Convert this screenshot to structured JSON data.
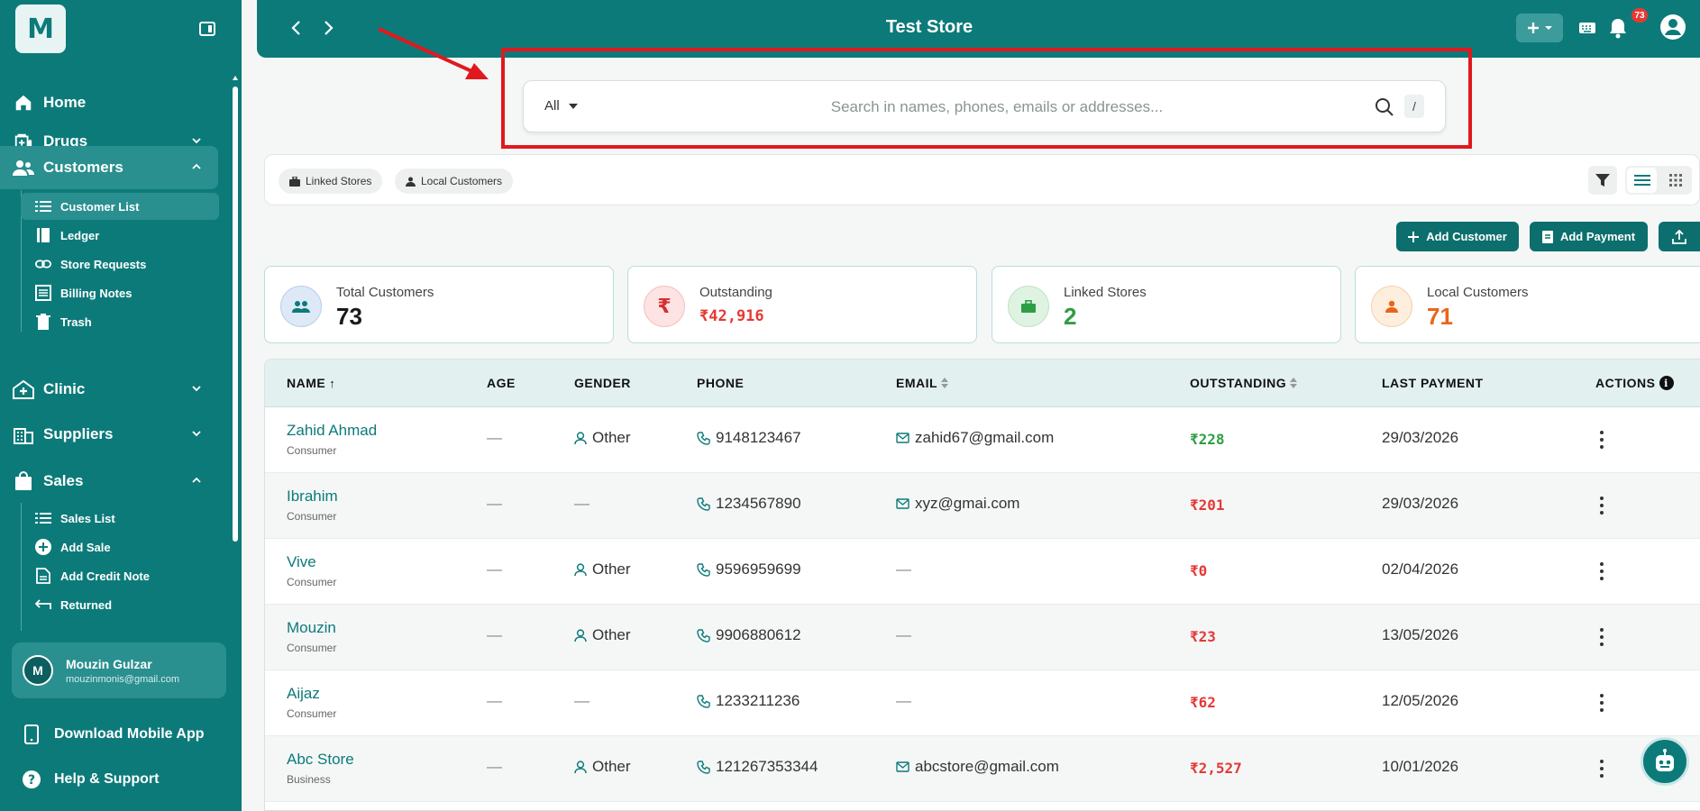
{
  "sidebar": {
    "logo_letter": "M",
    "nav": [
      {
        "label": "Home"
      },
      {
        "label": "Drugs"
      },
      {
        "label": "Customers"
      },
      {
        "label": "Clinic"
      },
      {
        "label": "Suppliers"
      },
      {
        "label": "Sales"
      }
    ],
    "customers_sub": [
      {
        "label": "Customer List"
      },
      {
        "label": "Ledger"
      },
      {
        "label": "Store Requests"
      },
      {
        "label": "Billing Notes"
      },
      {
        "label": "Trash"
      }
    ],
    "sales_sub": [
      {
        "label": "Sales List"
      },
      {
        "label": "Add Sale"
      },
      {
        "label": "Add Credit Note"
      },
      {
        "label": "Returned"
      }
    ],
    "user": {
      "initial": "M",
      "name": "Mouzin Gulzar",
      "email": "mouzinmonis@gmail.com"
    },
    "download_app": "Download Mobile App",
    "help": "Help & Support"
  },
  "topbar": {
    "title": "Test Store",
    "notifications_count": "73"
  },
  "search": {
    "filter": "All",
    "placeholder": "Search in names, phones, emails or addresses...",
    "shortcut": "/"
  },
  "filters": {
    "chips": [
      "Linked Stores",
      "Local Customers"
    ]
  },
  "actions": {
    "add_customer": "Add Customer",
    "add_payment": "Add Payment"
  },
  "stats": [
    {
      "label": "Total Customers",
      "value": "73",
      "color": "#1a1a1a"
    },
    {
      "label": "Outstanding",
      "value": "₹42,916",
      "color": "#e53935"
    },
    {
      "label": "Linked Stores",
      "value": "2",
      "color": "#2e9e44"
    },
    {
      "label": "Local Customers",
      "value": "71",
      "color": "#e8661a"
    }
  ],
  "table": {
    "headers": {
      "name": "NAME",
      "age": "AGE",
      "gender": "GENDER",
      "phone": "PHONE",
      "email": "EMAIL",
      "outstanding": "OUTSTANDING",
      "last_payment": "LAST PAYMENT",
      "actions": "ACTIONS"
    },
    "rows": [
      {
        "name": "Zahid Ahmad",
        "type": "Consumer",
        "age": "—",
        "gender": "Other",
        "phone": "9148123467",
        "email": "zahid67@gmail.com",
        "outstanding": "₹228",
        "outstanding_color": "#2e9e44",
        "last_payment": "29/03/2026"
      },
      {
        "name": "Ibrahim",
        "type": "Consumer",
        "age": "—",
        "gender": "—",
        "phone": "1234567890",
        "email": "xyz@gmai.com",
        "outstanding": "₹201",
        "outstanding_color": "#e53935",
        "last_payment": "29/03/2026"
      },
      {
        "name": "Vive",
        "type": "Consumer",
        "age": "—",
        "gender": "Other",
        "phone": "9596959699",
        "email": "—",
        "outstanding": "₹0",
        "outstanding_color": "#e53935",
        "last_payment": "02/04/2026"
      },
      {
        "name": "Mouzin",
        "type": "Consumer",
        "age": "—",
        "gender": "Other",
        "phone": "9906880612",
        "email": "—",
        "outstanding": "₹23",
        "outstanding_color": "#e53935",
        "last_payment": "13/05/2026"
      },
      {
        "name": "Aijaz",
        "type": "Consumer",
        "age": "—",
        "gender": "—",
        "phone": "1233211236",
        "email": "—",
        "outstanding": "₹62",
        "outstanding_color": "#e53935",
        "last_payment": "12/05/2026"
      },
      {
        "name": "Abc Store",
        "type": "Business",
        "age": "—",
        "gender": "Other",
        "phone": "121267353344",
        "email": "abcstore@gmail.com",
        "outstanding": "₹2,527",
        "outstanding_color": "#e53935",
        "last_payment": "10/01/2026"
      }
    ]
  },
  "colors": {
    "primary": "#0d7a7a",
    "highlight": "#e0191e"
  }
}
